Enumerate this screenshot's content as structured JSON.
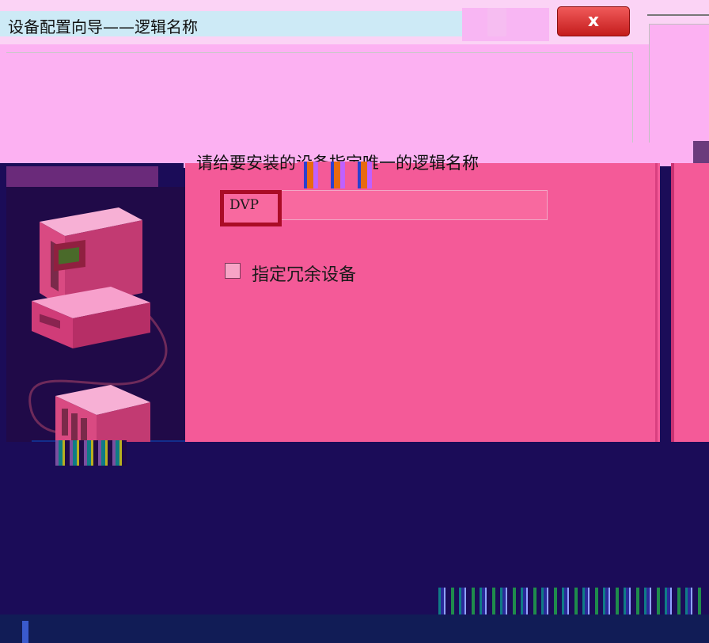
{
  "window": {
    "title": "设备配置向导——逻辑名称",
    "close_glyph": "x"
  },
  "wizard": {
    "instruction": "请给要安装的设备指定唯一的逻辑名称",
    "logical_name": {
      "value": "DVP"
    },
    "redundant_checkbox": {
      "label": "指定冗余设备",
      "checked": false
    }
  },
  "icons": {
    "computer": "computer-icon",
    "device": "controller-device-icon"
  },
  "colors": {
    "content_bg": "#f45a98",
    "header_bg": "#fcb1f2",
    "focus_border": "#aa0c26",
    "close_button": "#d42a2a",
    "bottom_bg": "#1b0c58"
  }
}
